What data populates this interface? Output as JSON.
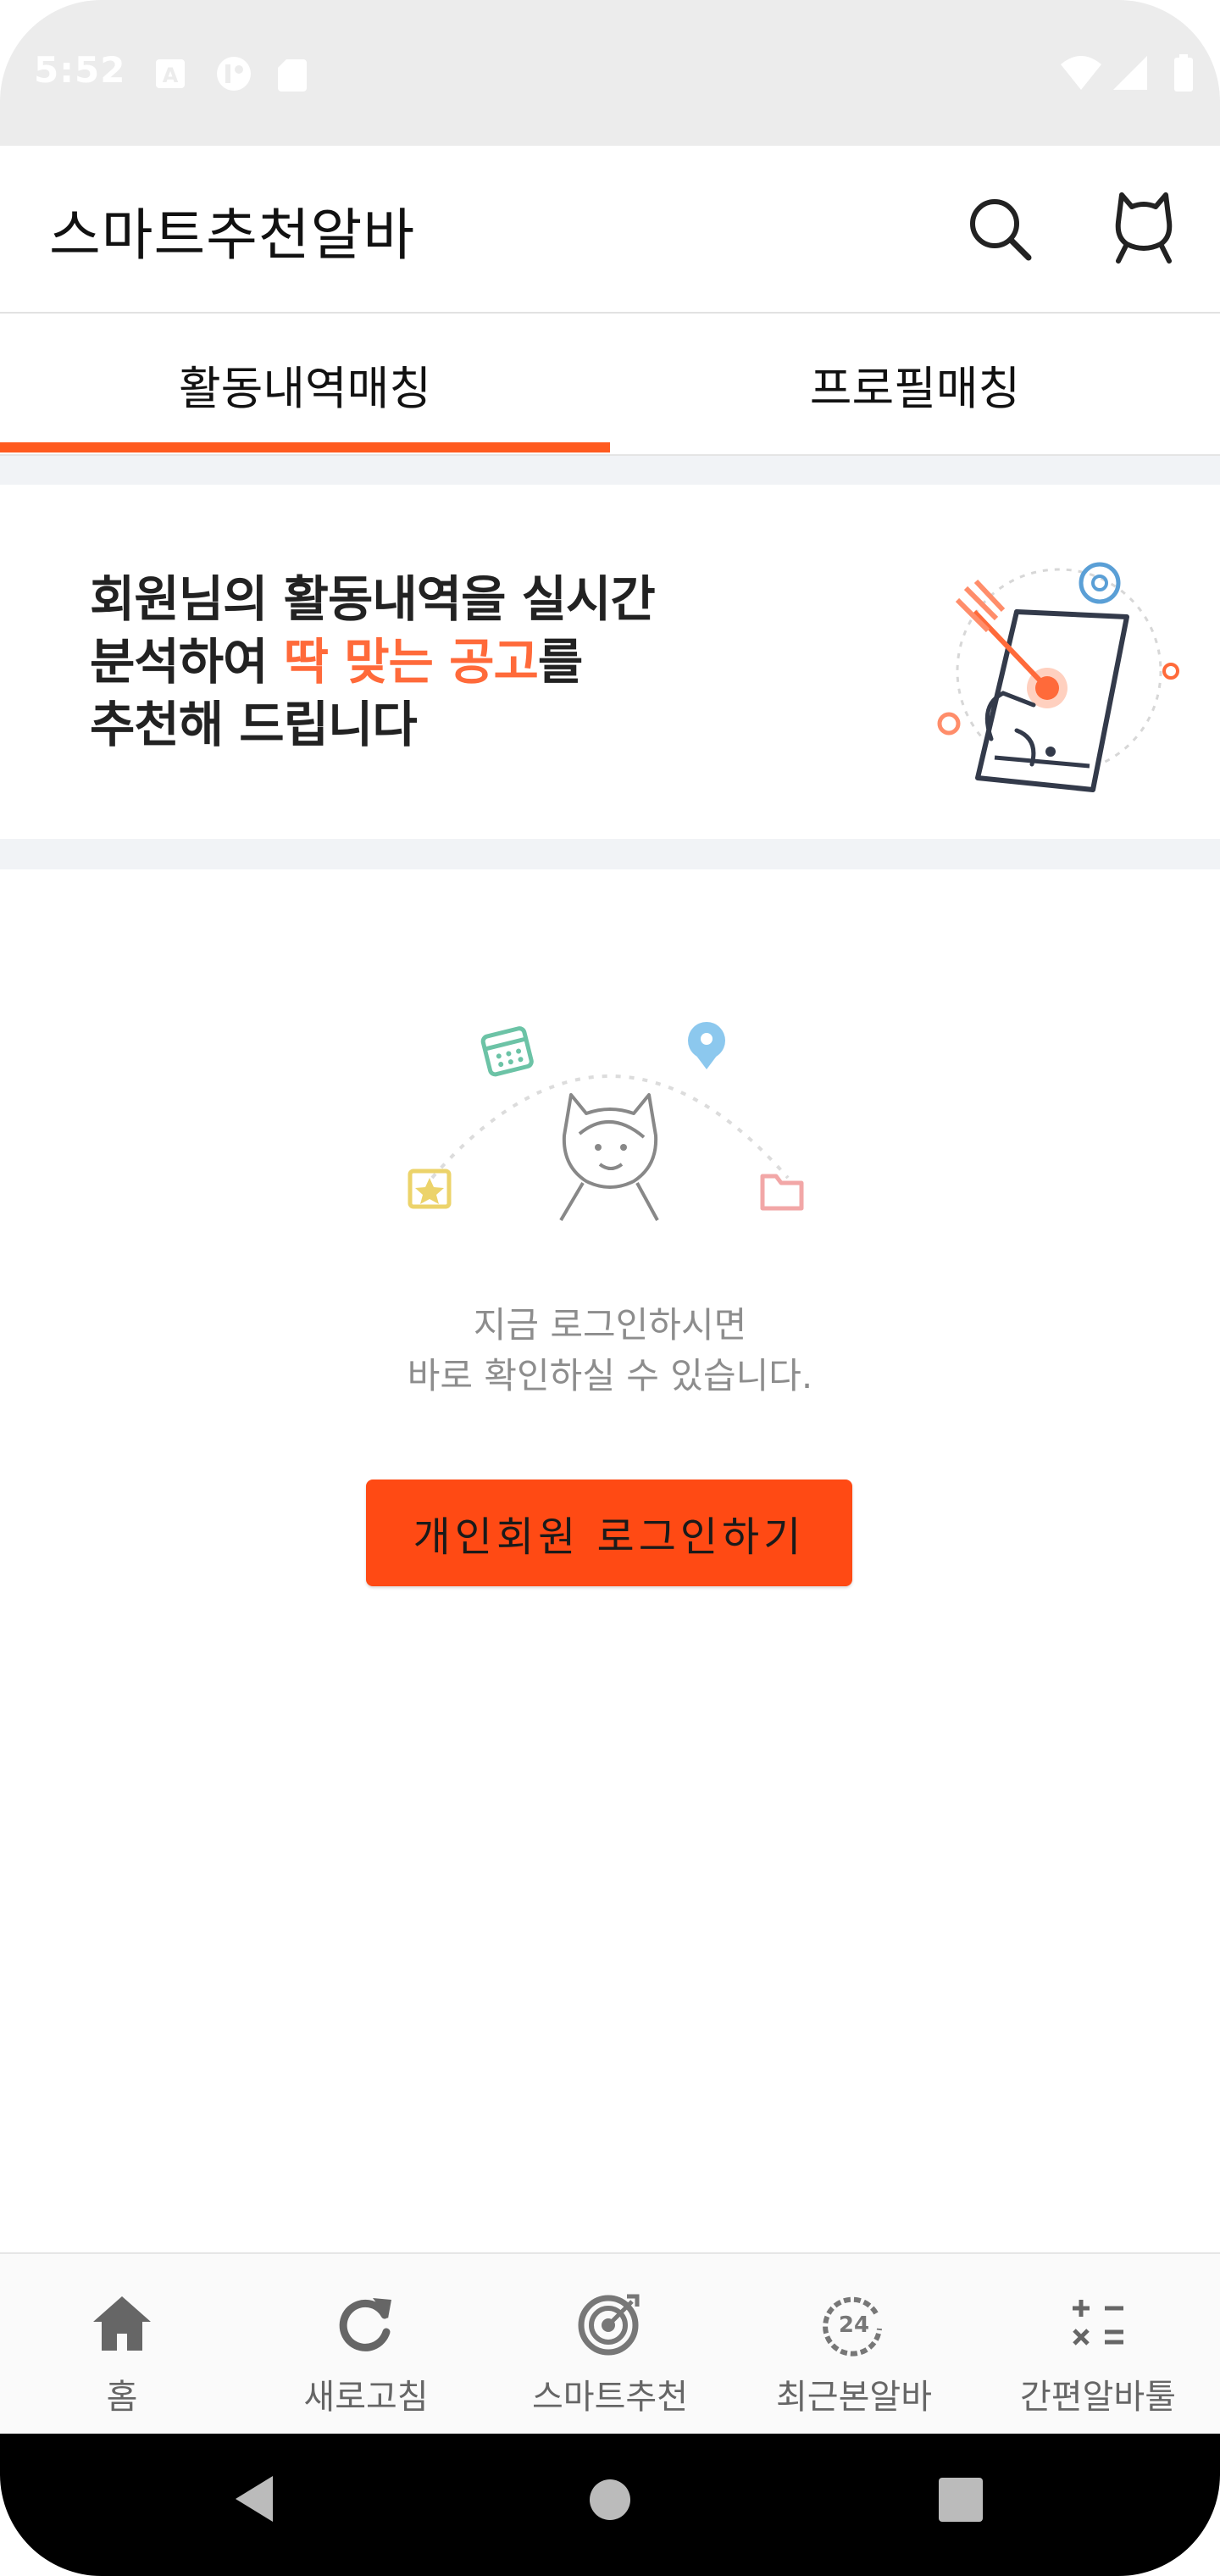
{
  "status_bar": {
    "time": "5:52"
  },
  "app_bar": {
    "title": "스마트추천알바"
  },
  "tabs": [
    {
      "label": "활동내역매칭",
      "selected": true
    },
    {
      "label": "프로필매칭",
      "selected": false
    }
  ],
  "banner": {
    "line1": "회원님의 활동내역을 실시간",
    "line2_prefix": "분석하여 ",
    "line2_highlight": "딱 맞는 공고",
    "line2_suffix": "를",
    "line3": "추천해 드립니다"
  },
  "empty_state": {
    "message_line1": "지금 로그인하시면",
    "message_line2": "바로 확인하실 수 있습니다.",
    "login_button": "개인회원 로그인하기"
  },
  "bottom_nav": [
    {
      "label": "홈",
      "icon": "home-icon"
    },
    {
      "label": "새로고침",
      "icon": "refresh-icon"
    },
    {
      "label": "스마트추천",
      "icon": "target-icon"
    },
    {
      "label": "최근본알바",
      "icon": "recent-24-icon"
    },
    {
      "label": "간편알바툴",
      "icon": "calculator-icon"
    }
  ],
  "colors": {
    "accent": "#ff4a14",
    "highlight": "#ff6a3a",
    "tab_indicator": "#ff5a1f"
  }
}
